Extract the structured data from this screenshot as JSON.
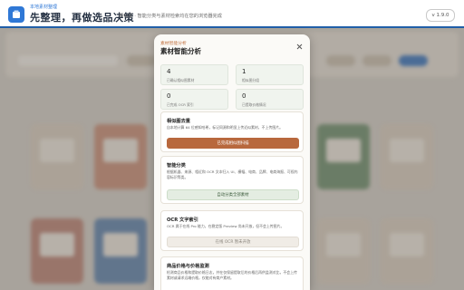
{
  "app": {
    "subtitle": "本地素材整理",
    "title": "先整理，再做选品决策",
    "description": "相似图 · 智能分类与素材检索均在您的浏览器完成",
    "version": "v 1.9.0",
    "accent": "#2f78d6"
  },
  "modal": {
    "subtitle": "素材智能分析",
    "title": "素材智能分析",
    "close_icon": "close-icon",
    "stats": [
      {
        "value": "4",
        "label": "已确认相似图素材"
      },
      {
        "value": "1",
        "label": "相似图分组"
      },
      {
        "value": "0",
        "label": "已完成 OCR 索引"
      },
      {
        "value": "0",
        "label": "已提取价格情况"
      }
    ],
    "sections": [
      {
        "title": "相似图去重",
        "desc": "自本地计算 64 位感知哈希，标记同源和明显上传近似素材，不上传图片。",
        "button": "已完成相似图扫描",
        "button_style": "primary"
      },
      {
        "title": "智能分类",
        "desc": "根据机器、来源、相近和 OCR 文本归入 UI、横幅、电商、品牌、电商海报、可视内容标识等类。",
        "button": "自动分类全部素材",
        "button_style": "green"
      },
      {
        "title": "OCR 文字索引",
        "desc": "OCR 属于在线 Pro 能力，在稳定版 Preview 尚未开放，但不会上传图片。",
        "button": "在线 OCR 暂未开放",
        "button_style": "disabled"
      },
      {
        "title": "商品价格与价格监测",
        "desc": "检测商品价格和提取价格日志，并在仅保留提取后的价格后再供监测对比，不会上传素材或请求远端价格，仅能对有商户素材。",
        "button": "",
        "button_style": "none"
      }
    ]
  }
}
